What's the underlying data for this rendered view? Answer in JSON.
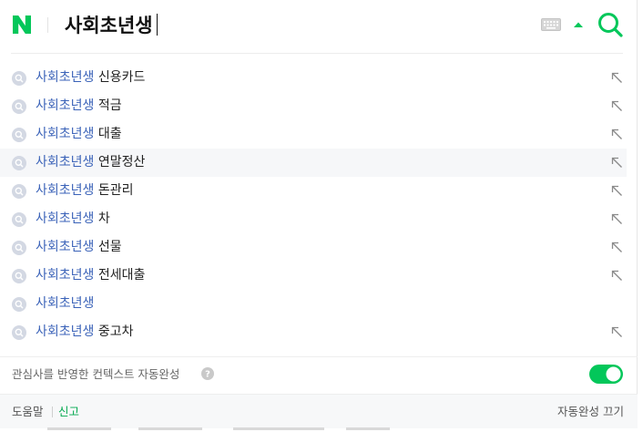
{
  "colors": {
    "brand": "#03c75a",
    "keyword": "#3a62b8",
    "toggle_on": "#03c75a"
  },
  "header": {
    "logo_icon": "naver-n-logo",
    "query": "사회초년생",
    "keyboard_icon": "keyboard-icon",
    "collapse_icon": "arrow-up-icon",
    "search_icon": "search-icon"
  },
  "suggestions": [
    {
      "keyword": "사회초년생",
      "rest": " 신용카드",
      "has_fill": true
    },
    {
      "keyword": "사회초년생",
      "rest": " 적금",
      "has_fill": true
    },
    {
      "keyword": "사회초년생",
      "rest": " 대출",
      "has_fill": true
    },
    {
      "keyword": "사회초년생",
      "rest": " 연말정산",
      "has_fill": true,
      "highlighted": true
    },
    {
      "keyword": "사회초년생",
      "rest": " 돈관리",
      "has_fill": true
    },
    {
      "keyword": "사회초년생",
      "rest": " 차",
      "has_fill": true
    },
    {
      "keyword": "사회초년생",
      "rest": " 선물",
      "has_fill": true
    },
    {
      "keyword": "사회초년생",
      "rest": " 전세대출",
      "has_fill": true
    },
    {
      "keyword": "사회초년생",
      "rest": "",
      "has_fill": false
    },
    {
      "keyword": "사회초년생",
      "rest": " 중고차",
      "has_fill": true
    }
  ],
  "context": {
    "label": "관심사를 반영한 컨텍스트 자동완성",
    "toggle_on": true
  },
  "footer": {
    "help": "도움말",
    "report": "신고",
    "autocomplete_off": "자동완성 끄기"
  }
}
